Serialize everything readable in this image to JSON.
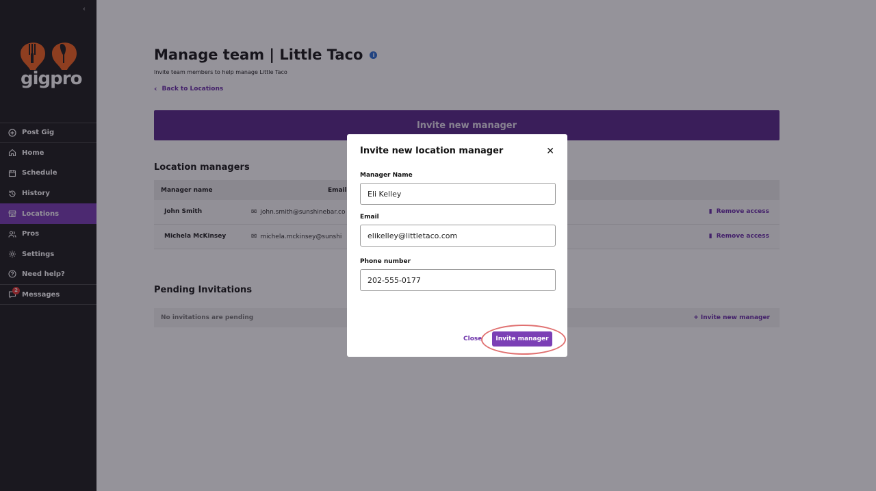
{
  "sidebar": {
    "collapse_icon": "chevron-left-icon",
    "logo_text": "gigpro",
    "brand_color": "#f26522",
    "items": [
      {
        "label": "Post Gig",
        "icon": "plus-circle-icon"
      },
      {
        "label": "Home",
        "icon": "home-icon"
      },
      {
        "label": "Schedule",
        "icon": "calendar-icon"
      },
      {
        "label": "History",
        "icon": "history-icon"
      },
      {
        "label": "Locations",
        "icon": "store-icon",
        "active": true
      },
      {
        "label": "Pros",
        "icon": "users-icon"
      },
      {
        "label": "Settings",
        "icon": "gear-icon"
      },
      {
        "label": "Need help?",
        "icon": "help-icon"
      },
      {
        "label": "Messages",
        "icon": "message-icon",
        "badge": "2"
      }
    ]
  },
  "page": {
    "title": "Manage team | Little Taco",
    "subtitle": "Invite team members to help manage Little Taco",
    "back_label": "Back to Locations",
    "invite_banner_label": "Invite new manager"
  },
  "managers": {
    "section_title": "Location managers",
    "col_name": "Manager name",
    "col_email": "Email",
    "rows": [
      {
        "name": "John Smith",
        "email": "john.smith@sunshinebar.co",
        "action": "Remove access"
      },
      {
        "name": "Michela McKinsey",
        "email": "michela.mckinsey@sunshi",
        "action": "Remove access"
      }
    ]
  },
  "pending": {
    "section_title": "Pending Invitations",
    "empty_text": "No invitations are pending",
    "invite_link": "+ Invite new manager"
  },
  "modal": {
    "title": "Invite new location manager",
    "name_label": "Manager Name",
    "name_value": "Eli Kelley",
    "email_label": "Email",
    "email_value": "elikelley@littletaco.com",
    "phone_label": "Phone number",
    "phone_value": "202-555-0177",
    "cancel_label": "Close",
    "submit_label": "Invite manager"
  },
  "colors": {
    "accent": "#7b3fb5",
    "banner": "#5a2a8a",
    "sidebar_bg": "#1f1f1f"
  }
}
